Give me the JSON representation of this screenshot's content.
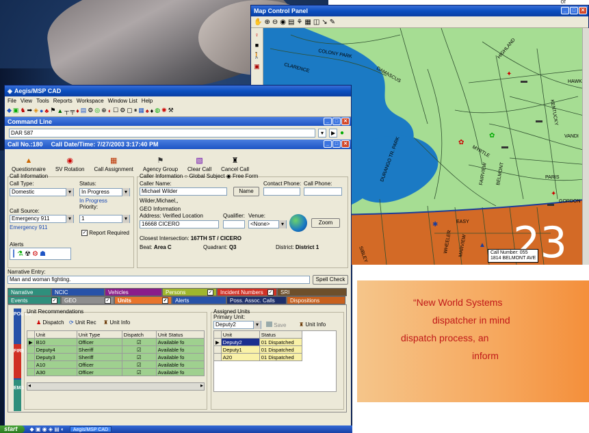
{
  "background": {
    "corner_text": "of"
  },
  "map": {
    "title": "Map Control Panel",
    "toolbar_icons": [
      "hand-icon",
      "zoom-in-icon",
      "zoom-out-icon",
      "globe-icon",
      "layers-icon",
      "tree-icon",
      "grid-icon",
      "window-icon",
      "pointer-icon",
      "paint-icon"
    ],
    "streets": [
      "CLARENCE",
      "COLONY PARK",
      "DAMASCUS",
      "HIGHLAND",
      "HAWKS",
      "KENTUCKY",
      "VANDI",
      "MYRTLE",
      "FAIRVIEW",
      "BELMONT",
      "PARIS",
      "GORDON",
      "EASY",
      "DURANGO TR. PARK",
      "WHEELER",
      "MARVIEW",
      "SIBLEY",
      "HAWKS"
    ],
    "district_number": "23",
    "callout": {
      "line1": "Call Number: 055",
      "line2": "1814 BELMONT AVE"
    },
    "colors": {
      "water": "#1b7ac4",
      "land": "#a6dd93",
      "district": "#d36a26"
    }
  },
  "cad": {
    "title": "Aegis/MSP CAD",
    "menu": [
      "File",
      "View",
      "Tools",
      "Reports",
      "Workspace",
      "Window List",
      "Help"
    ],
    "command_line": {
      "title": "Command Line",
      "value": "DAR 587"
    },
    "call_header": {
      "call_no": "Call No.:180",
      "call_datetime": "Call Date/Time: 7/27/2003 3:17:40 PM"
    },
    "actions": [
      "Questionnaire",
      "SV Rotation",
      "Call Assignment",
      "Agency Group",
      "Clear Call",
      "Cancel Call"
    ],
    "call_info": {
      "section": "Call Information",
      "call_type_label": "Call Type:",
      "call_type": "Domestic",
      "status_label": "Status:",
      "status": "In Progress",
      "status_note": "In Progress",
      "call_source_label": "Call Source:",
      "call_source": "Emergency 911",
      "call_source_note": "Emergency 911",
      "priority_label": "Priority:",
      "priority": "1",
      "report_required": "Report Required",
      "alerts_label": "Alerts"
    },
    "caller_info": {
      "section": "Caller Information",
      "global_subject": "Global Subject",
      "free_form": "Free Form",
      "caller_name_label": "Caller Name:",
      "caller_name": "Michael Wilder",
      "name_button": "Name",
      "contact_phone_label": "Contact Phone:",
      "call_phone_label": "Call Phone:",
      "caller_name_note": "Wilder,Michael,,"
    },
    "geo_info": {
      "section": "GEO Information",
      "address_label": "Address: Verified Location",
      "address": "16668 CICERO",
      "qualifier_label": "Qualifier:",
      "venue_label": "Venue:",
      "venue": "<None>",
      "zoom_button": "Zoom",
      "closest_label": "Closest Intersection:",
      "closest_value": "167TH ST / CICERO",
      "beat_label": "Beat:",
      "beat_value": "Area C",
      "quadrant_label": "Quadrant:",
      "quadrant_value": "Q3",
      "district_label": "District:",
      "district_value": "District 1"
    },
    "narrative": {
      "label": "Narrative Entry:",
      "value": "Man and woman fighting.",
      "spell_button": "Spell Check"
    },
    "tabs_row1": [
      "Narrative",
      "NCIC",
      "Vehicles",
      "Persons",
      "Incident Numbers",
      "SRI"
    ],
    "tabs_row2": [
      "Events",
      "GEO",
      "Units",
      "Alerts",
      "Poss. Assoc. Calls",
      "Dispositions"
    ],
    "side_tabs": [
      "POLICE",
      "FIRE",
      "EMS"
    ],
    "unit_recs": {
      "section": "Unit Recommendations",
      "buttons": [
        "Dispatch",
        "Unit Rec",
        "Unit Info"
      ],
      "columns": [
        "Unit",
        "Unit Type",
        "Dispatch",
        "Unit Status"
      ],
      "rows": [
        [
          "B10",
          "Officer",
          "☑",
          "Available fo"
        ],
        [
          "Deputy4",
          "Sheriff",
          "☑",
          "Available fo"
        ],
        [
          "Deputy3",
          "Sheriff",
          "☑",
          "Available fo"
        ],
        [
          "A10",
          "Officer",
          "☑",
          "Available fo"
        ],
        [
          "A30",
          "Officer",
          "☑",
          "Available fo"
        ]
      ]
    },
    "assigned": {
      "section": "Assigned Units",
      "primary_label": "Primary Unit:",
      "primary_value": "Deputy2",
      "save": "Save",
      "unit_info": "Unit Info",
      "columns": [
        "Unit",
        "Status"
      ],
      "rows": [
        [
          "Deputy2",
          "01 Dispatched"
        ],
        [
          "Deputy1",
          "01 Dispatched"
        ],
        [
          "A20",
          "01 Dispatched"
        ]
      ]
    }
  },
  "taskbar": {
    "start": "start",
    "task": "Aegis/MSP CAD"
  },
  "quote": {
    "lines": [
      "“New World Systems",
      "dispatcher in mind",
      "dispatch process, an",
      "inform"
    ]
  }
}
